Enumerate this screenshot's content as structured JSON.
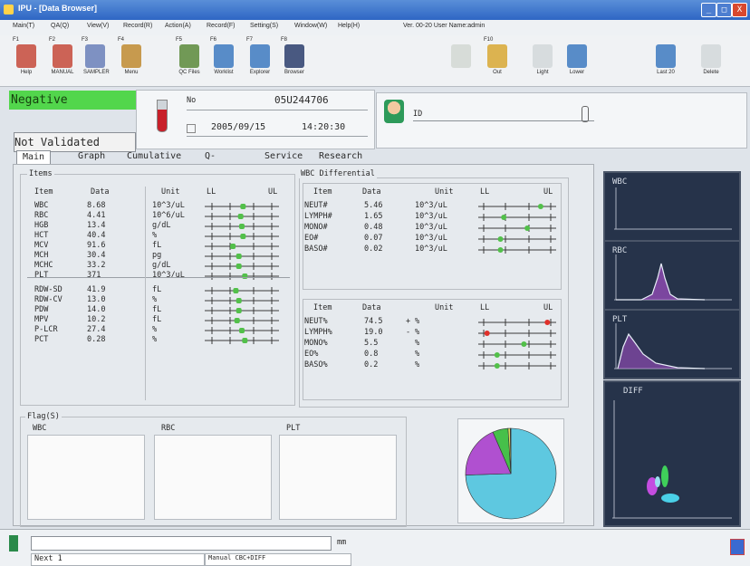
{
  "window": {
    "title": "IPU - [Data Browser]",
    "buttons": [
      "_",
      "□",
      "X"
    ]
  },
  "menu": [
    "Main(T)",
    "QA(Q)",
    "View(V)",
    "Record(R)",
    "Action(A)",
    "Record(F)",
    "Setting(S)",
    "Window(W)",
    "Help(H)",
    "Ver. 00-20 User Name:admin"
  ],
  "toolbar": [
    {
      "fkey": "F1",
      "label": "Help",
      "icon": "help-icon"
    },
    {
      "fkey": "F2",
      "label": "MANUAL",
      "icon": "manual-icon"
    },
    {
      "fkey": "F3",
      "label": "SAMPLER",
      "icon": "sampler-icon"
    },
    {
      "fkey": "F4",
      "label": "Menu",
      "icon": "menu-icon"
    },
    {
      "fkey": "F5",
      "label": "QC Files",
      "icon": "qc-files-icon"
    },
    {
      "fkey": "F6",
      "label": "Worklist",
      "icon": "worklist-icon"
    },
    {
      "fkey": "F7",
      "label": "Explorer",
      "icon": "explorer-icon"
    },
    {
      "fkey": "F8",
      "label": "Browser",
      "icon": "browser-icon"
    },
    {
      "fkey": "",
      "label": "",
      "icon": "disabled-icon"
    },
    {
      "fkey": "F10",
      "label": "Out",
      "icon": "output-icon"
    },
    {
      "fkey": "",
      "label": "Light",
      "icon": "light-icon"
    },
    {
      "fkey": "",
      "label": "Lower",
      "icon": "lower-icon"
    },
    {
      "fkey": "",
      "label": "Last 20",
      "icon": "last20-icon"
    },
    {
      "fkey": "",
      "label": "Delete",
      "icon": "delete-icon"
    }
  ],
  "status_result": "Negative",
  "validation": "Not Validated",
  "sample": {
    "no_label": "No",
    "number": "05U244706",
    "date": "2005/09/15",
    "time": "14:20:30"
  },
  "patient": {
    "id_label": "ID",
    "name": ""
  },
  "tabs": [
    "Main",
    "Graph",
    "Cumulative",
    "Q-Flags",
    "Service",
    "Research"
  ],
  "items": {
    "title": "Items",
    "headers": [
      "Item",
      "Data",
      "Unit",
      "LL",
      "UL"
    ],
    "rows": [
      {
        "item": "WBC",
        "data": "8.68",
        "unit": "10^3/uL",
        "pos": 0.52
      },
      {
        "item": "RBC",
        "data": "4.41",
        "unit": "10^6/uL",
        "pos": 0.48
      },
      {
        "item": "HGB",
        "data": "13.4",
        "unit": "g/dL",
        "pos": 0.5
      },
      {
        "item": "HCT",
        "data": "40.4",
        "unit": "%",
        "pos": 0.52
      },
      {
        "item": "MCV",
        "data": "91.6",
        "unit": "fL",
        "pos": 0.35
      },
      {
        "item": "MCH",
        "data": "30.4",
        "unit": "pg",
        "pos": 0.45
      },
      {
        "item": "MCHC",
        "data": "33.2",
        "unit": "g/dL",
        "pos": 0.45
      },
      {
        "item": "PLT",
        "data": "371",
        "unit": "10^3/uL",
        "pos": 0.55
      },
      {
        "item": "RDW-SD",
        "data": "41.9",
        "unit": "fL",
        "pos": 0.4
      },
      {
        "item": "RDW-CV",
        "data": "13.0",
        "unit": "%",
        "pos": 0.45
      },
      {
        "item": "PDW",
        "data": "14.0",
        "unit": "fL",
        "pos": 0.45
      },
      {
        "item": "MPV",
        "data": "10.2",
        "unit": "fL",
        "pos": 0.42
      },
      {
        "item": "P-LCR",
        "data": "27.4",
        "unit": "%",
        "pos": 0.5
      },
      {
        "item": "PCT",
        "data": "0.28",
        "unit": "%",
        "pos": 0.55
      }
    ]
  },
  "wbc_diff": {
    "title": "WBC Differential",
    "headers": [
      "Item",
      "Data",
      "Unit",
      "LL",
      "UL"
    ],
    "abs_rows": [
      {
        "item": "NEUT#",
        "data": "5.46",
        "flag": "",
        "unit": "10^3/uL",
        "pos": 0.85,
        "color": "#52c04a"
      },
      {
        "item": "LYMPH#",
        "data": "1.65",
        "flag": "",
        "unit": "10^3/uL",
        "pos": 0.3,
        "color": "#52c04a"
      },
      {
        "item": "MONO#",
        "data": "0.48",
        "flag": "",
        "unit": "10^3/uL",
        "pos": 0.65,
        "color": "#52c04a"
      },
      {
        "item": "EO#",
        "data": "0.07",
        "flag": "",
        "unit": "10^3/uL",
        "pos": 0.25,
        "color": "#52c04a"
      },
      {
        "item": "BASO#",
        "data": "0.02",
        "flag": "",
        "unit": "10^3/uL",
        "pos": 0.25,
        "color": "#52c04a"
      }
    ],
    "pct_rows": [
      {
        "item": "NEUT%",
        "data": "74.5",
        "flag": "+",
        "unit": "%",
        "pos": 0.95,
        "color": "#e0302a"
      },
      {
        "item": "LYMPH%",
        "data": "19.0",
        "flag": "-",
        "unit": "%",
        "pos": 0.05,
        "color": "#e0302a"
      },
      {
        "item": "MONO%",
        "data": "5.5",
        "flag": "",
        "unit": "%",
        "pos": 0.6,
        "color": "#52c04a"
      },
      {
        "item": "EO%",
        "data": "0.8",
        "flag": "",
        "unit": "%",
        "pos": 0.2,
        "color": "#52c04a"
      },
      {
        "item": "BASO%",
        "data": "0.2",
        "flag": "",
        "unit": "%",
        "pos": 0.2,
        "color": "#52c04a"
      }
    ]
  },
  "flags": {
    "title": "Flag(S)",
    "boxes": [
      "WBC",
      "RBC",
      "PLT"
    ]
  },
  "pie": [
    {
      "name": "neut",
      "value": 74.5,
      "color": "#5ec8e0"
    },
    {
      "name": "lymph",
      "value": 19.0,
      "color": "#b050d0"
    },
    {
      "name": "mono",
      "value": 5.5,
      "color": "#46c04a"
    },
    {
      "name": "eo",
      "value": 0.8,
      "color": "#e0e060"
    },
    {
      "name": "baso",
      "value": 0.2,
      "color": "#d05a40"
    }
  ],
  "graphs": {
    "wbc": "WBC",
    "rbc": "RBC",
    "plt": "PLT",
    "diff": "DIFF"
  },
  "status": {
    "left": "Next 1",
    "mode": "Manual CBC+DIFF",
    "unit": "mm"
  },
  "colors": {
    "accent_green": "#52d64c",
    "title_blue": "#2e66c4",
    "graph_bg": "#26334a"
  }
}
